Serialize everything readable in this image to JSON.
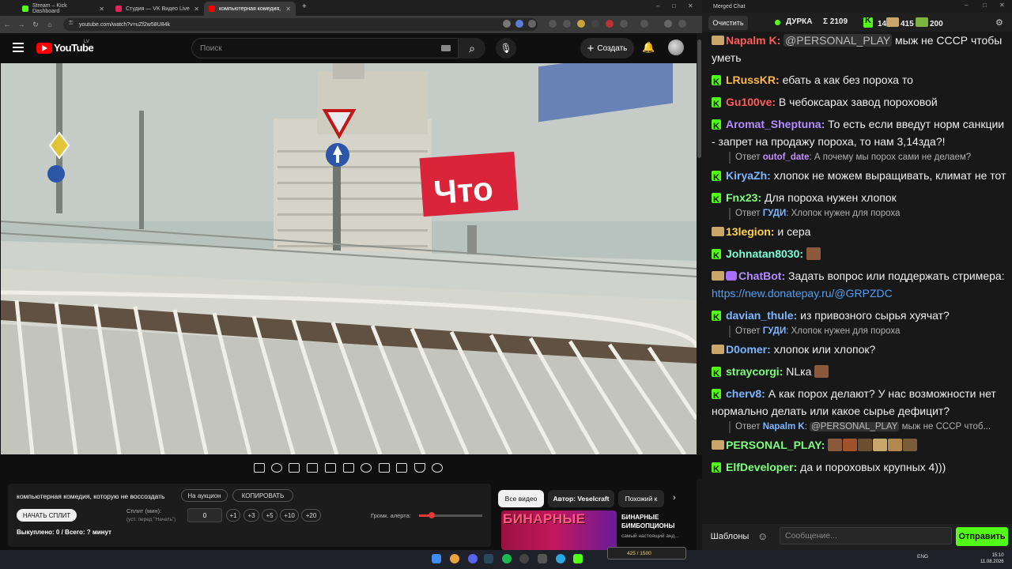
{
  "browser": {
    "tabs": [
      {
        "title": "Stream – Kick Dashboard",
        "color": "#53fc18"
      },
      {
        "title": "Студия — VK Видео Live",
        "color": "#e0245e"
      },
      {
        "title": "компьютерная комедия, которую",
        "color": "#ff0000"
      }
    ],
    "url": "youtube.com/watch?v=uZf2w58U84k"
  },
  "youtube": {
    "logo": "YouTube",
    "country": "LV",
    "search_placeholder": "Поиск",
    "create_label": "Создать"
  },
  "video": {
    "billboard_text": "Что"
  },
  "panel": {
    "title": "компьютерная комедия, которую не воссоздать",
    "auction_label": "На аукцион",
    "copy_label": "КОПИРОВАТЬ",
    "start_split_label": "НАЧАТЬ СПЛИТ",
    "split_label": "Сплит (мин):",
    "split_sub": "(уст. перед \"Начать\")",
    "split_value": "0",
    "increments": [
      "+1",
      "+3",
      "+5",
      "+10",
      "+20"
    ],
    "bought": "Выкуплено: 0 / Всего: ? минут",
    "alert_volume_label": "Громк. алерта:",
    "alert_volume": 0.2
  },
  "recommendations": {
    "tabs": [
      "Все видео",
      "Автор: Veselcraft",
      "Похожий к"
    ],
    "video_title": "БИНАРНЫЕ БИМБОПЦИОНЫ",
    "video_channel": "самый настоящий анд...",
    "thumb_text": "БИНАРНЫЕ"
  },
  "taskbar": {
    "lang": "ENG",
    "time": "15:10",
    "date": "11.08.2026",
    "donate_text": "425 / 1500"
  },
  "chat": {
    "window_title": "Merged Chat",
    "clear_label": "Очистить",
    "channel": "ДУРКА",
    "stats": [
      "Σ 2109",
      "1494",
      "415",
      "200"
    ],
    "templates_label": "Шаблоны",
    "input_placeholder": "Сообщение...",
    "send_label": "Отправить",
    "messages": [
      {
        "platform": "vk",
        "user": "Napalm K",
        "color": "#ff5c5c",
        "mention": "@PERSONAL_PLAY",
        "text": " мыж не СССР чтобы уметь"
      },
      {
        "platform": "kick",
        "user": "LRussKR",
        "color": "#ffb84d",
        "text": " ебать а как без пороха то"
      },
      {
        "platform": "kick",
        "user": "Gu100ve",
        "color": "#ff5c5c",
        "text": " В чебоксарах завод пороховой"
      },
      {
        "platform": "kick",
        "user": "Aromat_Sheptuna",
        "color": "#b48cff",
        "text": " То есть если введут норм санкции - запрет на продажу пороха, то нам 3,14зда?!"
      },
      {
        "reply": true,
        "prefix": "Ответ",
        "user": "outof_date",
        "color": "#c58cff",
        "text": " А почему мы порох сами не делаем?"
      },
      {
        "platform": "kick",
        "user": "KiryaZh",
        "color": "#7eb6ff",
        "text": " хлопок не можем выращивать, климат не тот"
      },
      {
        "platform": "kick",
        "user": "Fnx23",
        "color": "#7dff7d",
        "text": " Для пороха нужен хлопок"
      },
      {
        "reply": true,
        "prefix": "Ответ",
        "user": "ГУДИ",
        "color": "#7eb6ff",
        "text": " Хлопок нужен для пороха"
      },
      {
        "platform": "vk",
        "user": "13legion",
        "color": "#ffd24d",
        "text": " и сера"
      },
      {
        "platform": "kick",
        "user": "Johnatan8030",
        "color": "#7dffd8",
        "text": " ",
        "emotes": 1
      },
      {
        "platform": "vkbot",
        "user": "ChatBot",
        "color": "#b48cff",
        "text": " Задать вопрос или поддержать стримера: ",
        "link": "https://new.donatepay.ru/@GRPZDC"
      },
      {
        "platform": "kick",
        "user": "davian_thule",
        "color": "#7eb6ff",
        "text": " из привозного сырья хуячат?"
      },
      {
        "reply": true,
        "prefix": "Ответ",
        "user": "ГУДИ",
        "color": "#7eb6ff",
        "text": " Хлопок нужен для пороха"
      },
      {
        "platform": "vk",
        "user": "D0omer",
        "color": "#7eb6ff",
        "text": " хлопок или хлопок?"
      },
      {
        "platform": "kick",
        "user": "straycorgi",
        "color": "#7dff7d",
        "text": " NLка ",
        "emotes": 1
      },
      {
        "platform": "kick",
        "user": "cherv8",
        "color": "#7eb6ff",
        "text": " А как порох делают? У нас возможности нет нормально делать или какое сырье дефицит?"
      },
      {
        "reply": true,
        "prefix": "Ответ",
        "user": "Napalm K",
        "color": "#7eb6ff",
        "mention": "@PERSONAL_PLAY",
        "text": " мыж не СССР чтоб..."
      },
      {
        "platform": "vk",
        "user": "PERSONAL_PLAY",
        "color": "#7dff7d",
        "text": " ",
        "emotes": 6
      },
      {
        "platform": "kick",
        "user": "ElfDeveloper",
        "color": "#7dff7d",
        "text": " да и пороховых крупных 4)))"
      }
    ]
  }
}
